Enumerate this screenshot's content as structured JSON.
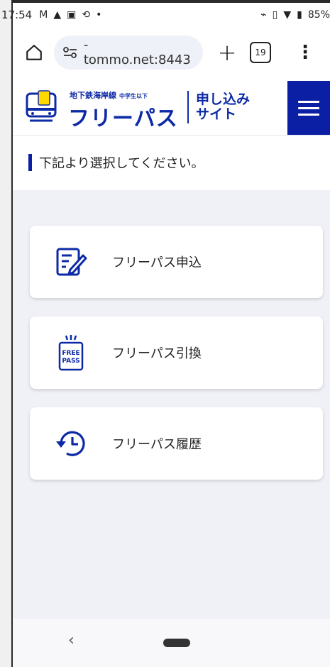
{
  "status_bar": {
    "time": "17:54",
    "battery": "85%"
  },
  "browser": {
    "url": "-tommo.net:8443",
    "tab_count": "19"
  },
  "header": {
    "logo_line1": "地下鉄海岸線",
    "logo_line1_sub": "中学生以下",
    "logo_main": "フリーパス",
    "apply_line1": "申し込み",
    "apply_line2": "サイト"
  },
  "instruction": "下記より選択してください。",
  "cards": [
    {
      "label": "フリーパス申込",
      "icon": "form-edit-icon"
    },
    {
      "label": "フリーパス引換",
      "icon": "free-pass-icon"
    },
    {
      "label": "フリーパス履歴",
      "icon": "history-icon"
    }
  ],
  "colors": {
    "brand": "#0b1fa5",
    "background": "#f0f1f6"
  }
}
